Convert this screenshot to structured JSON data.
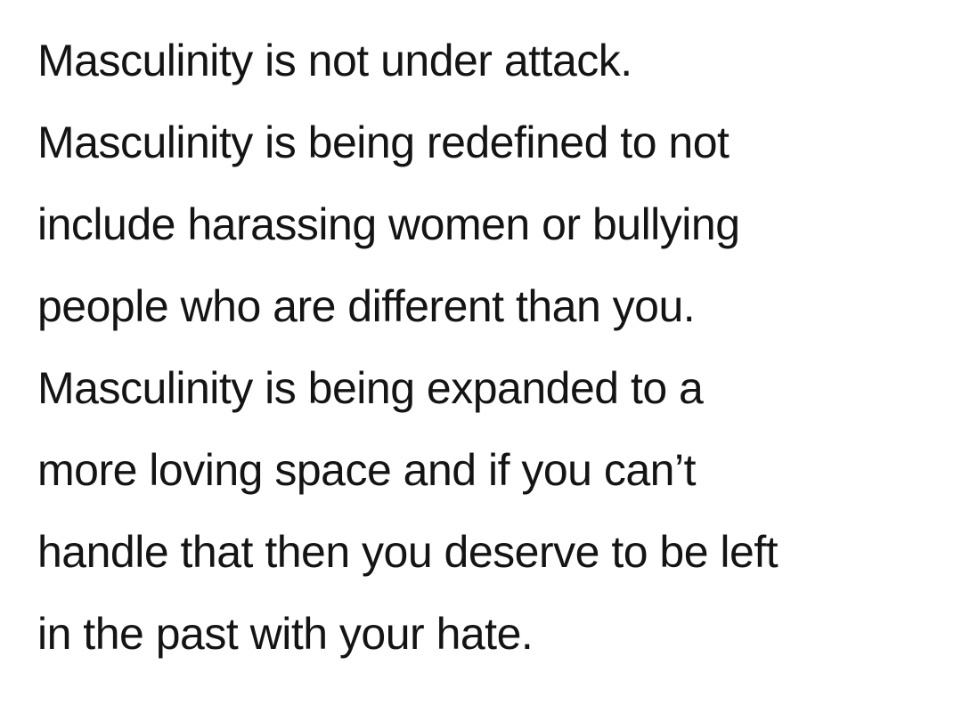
{
  "quote": {
    "lines": [
      "Masculinity is not under attack.",
      "Masculinity is being redefined to not",
      "include harassing women or bullying",
      "people who are different than you.",
      "Masculinity is being expanded to a",
      "more loving space and if you can’t",
      "handle that then you deserve to be left",
      "in the past with your hate."
    ]
  }
}
